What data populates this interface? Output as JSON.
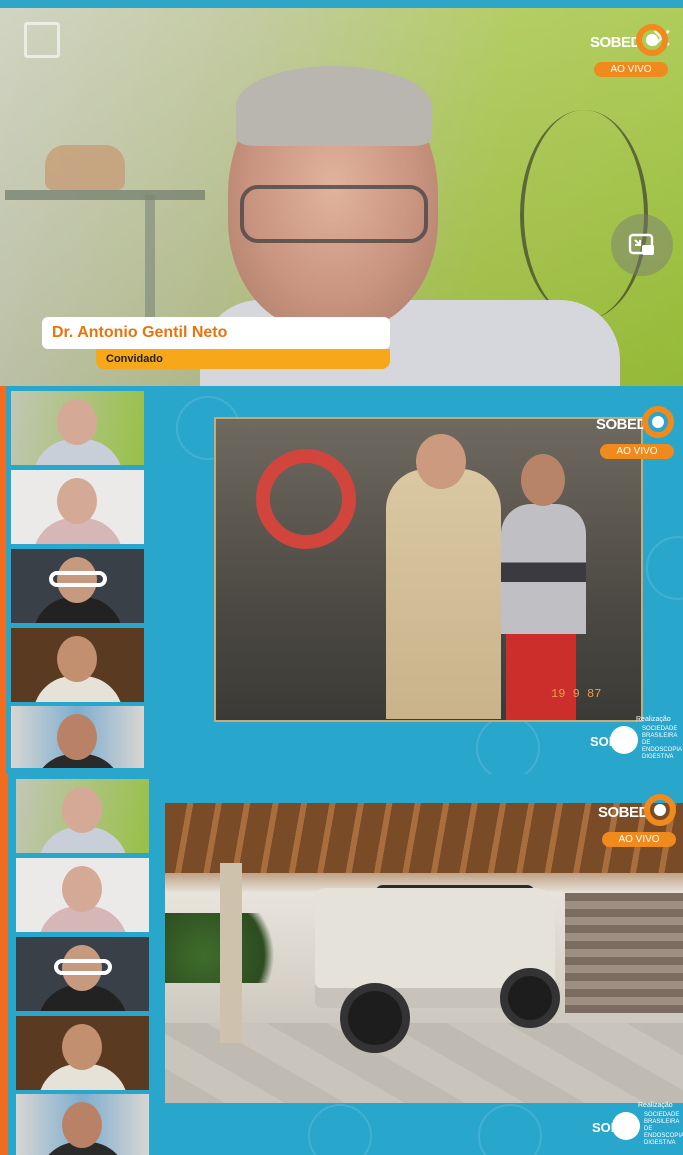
{
  "speaker": {
    "name": "Dr. Antonio Gentil Neto",
    "role": "Convidado"
  },
  "branding": {
    "logo_text": "SOBED",
    "live_label": "AO VIVO",
    "sponsor_tag": "Realização",
    "sponsor_brand": "SOBED",
    "sponsor_text": "SOCIEDADE BRASILEIRA DE ENDOSCOPIA DIGESTIVA"
  },
  "photo": {
    "date_stamp": "19 9 87"
  },
  "colors": {
    "accent_orange": "#f08a1c",
    "panel_blue": "#29a6cc",
    "role_bar": "#f6a81a"
  },
  "icons": {
    "collapse": "collapse-icon",
    "close": "close-icon",
    "pip": "picture-in-picture-icon"
  }
}
